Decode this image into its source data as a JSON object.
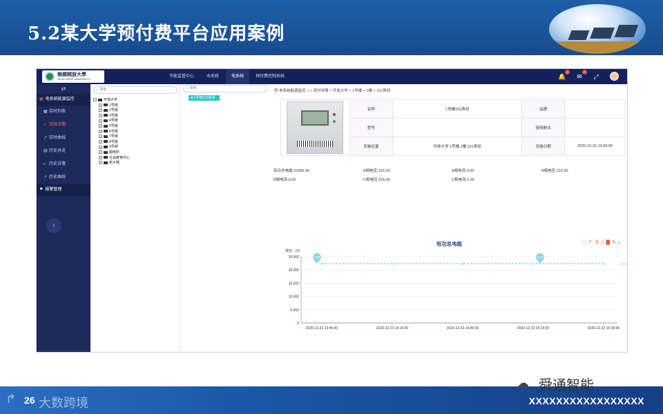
{
  "slide": {
    "title": "5.2某大学预付费平台应用案例",
    "page_number": "26",
    "footer_code": "XXXXXXXXXXXXXXXXX",
    "watermark_brand": "舜通智能",
    "watermark_left": "大数跨境"
  },
  "app": {
    "logo_text": "無錫開放大學",
    "logo_sub": "WUXI OPEN UNIVERSITY",
    "nav": [
      "节能监管中心",
      "水系统",
      "电系统",
      "预付费控制系统"
    ],
    "active_nav": "电系统",
    "badges": {
      "bell": "3",
      "mail": "3"
    },
    "icons": [
      "bell-icon",
      "mail-icon",
      "fullscreen-icon",
      "avatar"
    ]
  },
  "sidebar": {
    "group": "电系统能源监控",
    "items": [
      "实时列表",
      "实时详情",
      "实时曲线",
      "历史总览",
      "历史详情",
      "历史曲线"
    ],
    "active_item": "实时详情",
    "alarm": "报警管理"
  },
  "tree": {
    "search_placeholder": "搜索",
    "root": "开放大学",
    "children": [
      "1号楼",
      "2号楼",
      "3号楼",
      "4号楼",
      "5号楼",
      "6号楼",
      "7号楼",
      "8号楼",
      "9号楼",
      "图电所",
      "社会教育中心",
      "新大楼"
    ]
  },
  "rooms": {
    "search_placeholder": "搜索",
    "selected": "1号楼101房间"
  },
  "detail": {
    "breadcrumb": [
      "电系统能源监控",
      "实时详情",
      "开放大学",
      "1号楼",
      "1楼",
      "101房间"
    ],
    "labels": {
      "name": "名称",
      "brand": "品牌",
      "model": "型号",
      "wiring": "接线制式",
      "location": "安装位置",
      "install_date": "安装日期"
    },
    "values": {
      "name": "1号楼101房间",
      "brand": "",
      "model": "",
      "wiring": "",
      "location": "开放大学,1号楼,1楼,101房间",
      "install_date": "2020-10-31 10:59:00"
    },
    "readings": [
      "有功总电能:22360.00",
      "A相电压:215.39",
      "A相电流:0.00",
      "B相电压:215.30",
      "B相电流:6.00",
      "C相电压:215.00",
      "C相电流:2.00"
    ]
  },
  "chart_data": {
    "type": "line",
    "title": "有功总电能",
    "ylabel": "单位：(V)",
    "ylim": [
      0,
      25000
    ],
    "yticks": [
      "0",
      "5,000",
      "10,000",
      "15,000",
      "20,000",
      "25,000"
    ],
    "x": [
      "2020-12-23 13:45:00",
      "2020-12-23 14:15:00",
      "2020-12-23 14:45:00",
      "2020-12-23 15:15:00",
      "2020-12-23 15:30:06"
    ],
    "series": [
      {
        "values": [
          22360,
          22360,
          22360,
          22360,
          22360
        ]
      }
    ],
    "markpoints": [
      "22360",
      "22360"
    ],
    "markline_label": "22360.00",
    "color": "#8fd3e8",
    "toolbox_icons": [
      "zoom-icon",
      "zoom-reset-icon",
      "data-view-icon",
      "line-icon",
      "bar-icon",
      "restore-icon",
      "download-icon"
    ]
  }
}
